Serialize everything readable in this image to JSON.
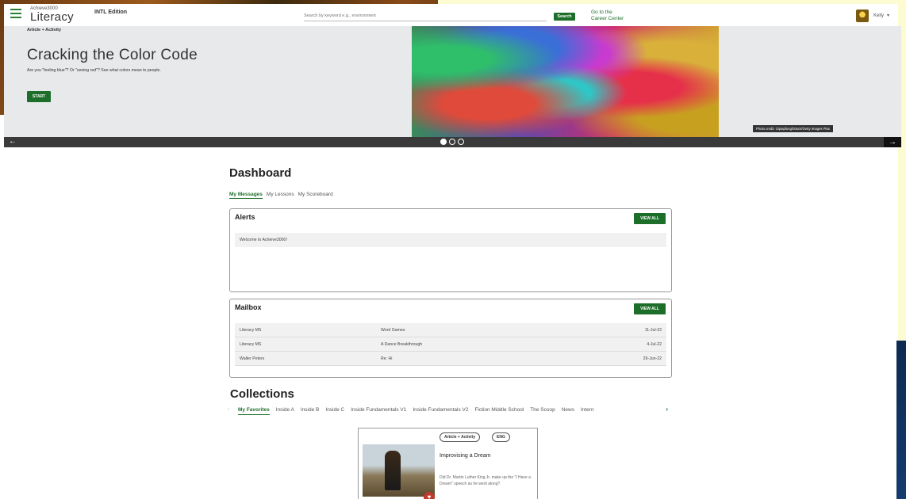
{
  "header": {
    "logo_top": "Achieve3000",
    "logo_main": "Literacy",
    "edition": "INTL Edition",
    "search_placeholder": "Search by keyword e.g., environment",
    "search_label": "Search",
    "career_line1": "Go to the",
    "career_line2": "Career Center",
    "user_name": "Kelly",
    "user_caret": "▾"
  },
  "hero": {
    "kicker": "Article + Activity",
    "title": "Cracking the Color Code",
    "description": "Are you \"feeling blue\"? Or \"seeing red\"? See what colors mean to people.",
    "start_label": "START",
    "photo_credit": "Photo credit: Gipiapfung/iStock/Getty Images Plus",
    "prev_icon": "←",
    "next_icon": "→",
    "slide_count": 3,
    "active_slide": 1
  },
  "dashboard": {
    "title": "Dashboard",
    "tabs": [
      {
        "label": "My Messages"
      },
      {
        "label": "My Lessons"
      },
      {
        "label": "My Scoreboard"
      }
    ],
    "alerts": {
      "title": "Alerts",
      "view_all": "VIEW ALL",
      "items": [
        "Welcome to Achieve3000!"
      ]
    },
    "mailbox": {
      "title": "Mailbox",
      "view_all": "VIEW ALL",
      "rows": [
        {
          "from": "Literacy MS",
          "subject": "Word Games",
          "date": "11-Jul-22"
        },
        {
          "from": "Literacy MS",
          "subject": "A Dance Breakthrough",
          "date": "4-Jul-22"
        },
        {
          "from": "Walter Peters",
          "subject": "Re: Hi",
          "date": "29-Jun-22"
        }
      ]
    }
  },
  "collections": {
    "title": "Collections",
    "prev_icon": "‹",
    "next_icon": "›",
    "tabs": [
      {
        "label": "My Favorites"
      },
      {
        "label": "Inside A"
      },
      {
        "label": "Inside B"
      },
      {
        "label": "Inside C"
      },
      {
        "label": "Inside Fundamentals V1"
      },
      {
        "label": "Inside Fundamentals V2"
      },
      {
        "label": "Fiction Middle School"
      },
      {
        "label": "The Scoop"
      },
      {
        "label": "News"
      },
      {
        "label": "Intern"
      }
    ],
    "card": {
      "tag1": "Article + Activity",
      "tag2": "ENG",
      "title": "Improvising a Dream",
      "description": "Did Dr. Martin Luther King Jr. make up the \"I Have a Dream\" speech as he went along?",
      "heart_icon": "♥"
    }
  },
  "colors": {
    "accent_green": "#1e6e2b",
    "hero_bg": "#e7e9ea",
    "dark_bar": "#3a3a3a"
  }
}
